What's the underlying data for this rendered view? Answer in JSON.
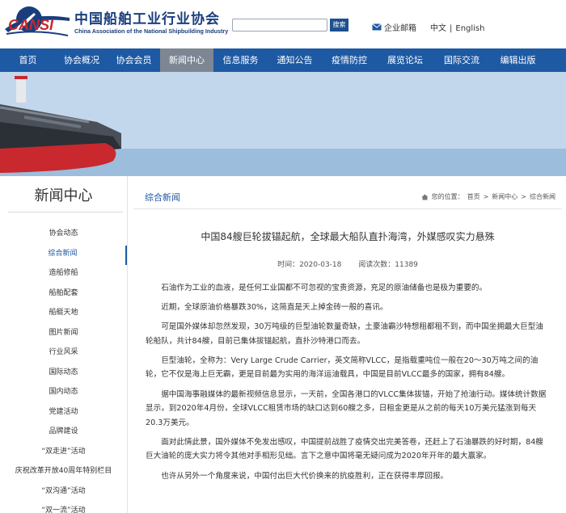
{
  "header": {
    "logo_text": "CANSI",
    "org_name_cn": "中国船舶工业行业协会",
    "org_name_en": "China Association of the National Shipbuilding Industry",
    "search_placeholder": "",
    "search_button": "搜索",
    "mail_label": "企业邮箱",
    "lang_cn": "中文",
    "lang_sep": "|",
    "lang_en": "English"
  },
  "nav": {
    "items": [
      {
        "label": "首页"
      },
      {
        "label": "协会概况"
      },
      {
        "label": "协会会员"
      },
      {
        "label": "新闻中心"
      },
      {
        "label": "信息服务"
      },
      {
        "label": "通知公告"
      },
      {
        "label": "疫情防控"
      },
      {
        "label": "展览论坛"
      },
      {
        "label": "国际交流"
      },
      {
        "label": "编辑出版"
      }
    ],
    "active_index": 3
  },
  "sidebar": {
    "title": "新闻中心",
    "items": [
      {
        "label": "协会动态"
      },
      {
        "label": "综合新闻"
      },
      {
        "label": "造船修船"
      },
      {
        "label": "船舶配套"
      },
      {
        "label": "船艇天地"
      },
      {
        "label": "图片新闻"
      },
      {
        "label": "行业风采"
      },
      {
        "label": "国际动态"
      },
      {
        "label": "国内动态"
      },
      {
        "label": "党建活动"
      },
      {
        "label": "品牌建设"
      },
      {
        "label": "“双走进”活动"
      },
      {
        "label": "庆祝改革开放40周年特别栏目"
      },
      {
        "label": "“双沟通”活动"
      },
      {
        "label": "“双一流”活动"
      }
    ],
    "active_index": 1
  },
  "crumb": {
    "section_title": "综合新闻",
    "prefix": "您的位置：",
    "home": "首页",
    "sep": ">",
    "level1": "新闻中心",
    "level2": "综合新闻"
  },
  "article": {
    "title": "中国84艘巨轮拔锚起航，全球最大船队直扑海湾，外媒感叹实力悬殊",
    "time": "时间：2020-03-18",
    "views": "阅读次数：11389",
    "paragraphs": [
      "石油作为工业的血液，是任何工业国都不可忽视的宝贵资源，充足的原油储备也是极为重要的。",
      "近期，全球原油价格暴跌30%，这简直是天上掉金砖一般的喜讯。",
      "可是国外媒体却忽然发现，30万吨级的巨型油轮数量奇缺，土豪油霸沙特想租都租不到，而中国坐拥最大巨型油轮船队，共计84艘，目前已集体拔锚起航，直扑沙特港口而去。",
      "巨型油轮，全称为：Very Large Crude Carrier，英文简称VLCC，是指载重吨位一般在20～30万吨之间的油轮，它不仅是海上巨无霸，更是目前最为实用的海洋运油载具，中国是目前VLCC最多的国家，拥有84艘。",
      "据中国海事融媒体的最新视频信息显示，一天前，全国各港口的VLCC集体拔锚，开始了抢油行动。媒体统计数据显示，到2020年4月份，全球VLCC租赁市场的缺口达到60艘之多，日租金更是从之前的每天10万美元猛涨到每天20.3万美元。",
      "面对此情此景，国外媒体不免发出感叹，中国提前战胜了疫情交出完美答卷，还赶上了石油暴跌的好时期，84艘巨大油轮的庞大实力将令其他对手相形见绌。言下之意中国将毫无疑问成为2020年开年的最大赢家。",
      "也许从另外一个角度来说，中国付出巨大代价换来的抗疫胜利，正在获得丰厚回报。"
    ]
  },
  "colors": {
    "brand_blue": "#1e59a3",
    "nav_active": "#7d8794",
    "hull_red": "#c8282e"
  }
}
